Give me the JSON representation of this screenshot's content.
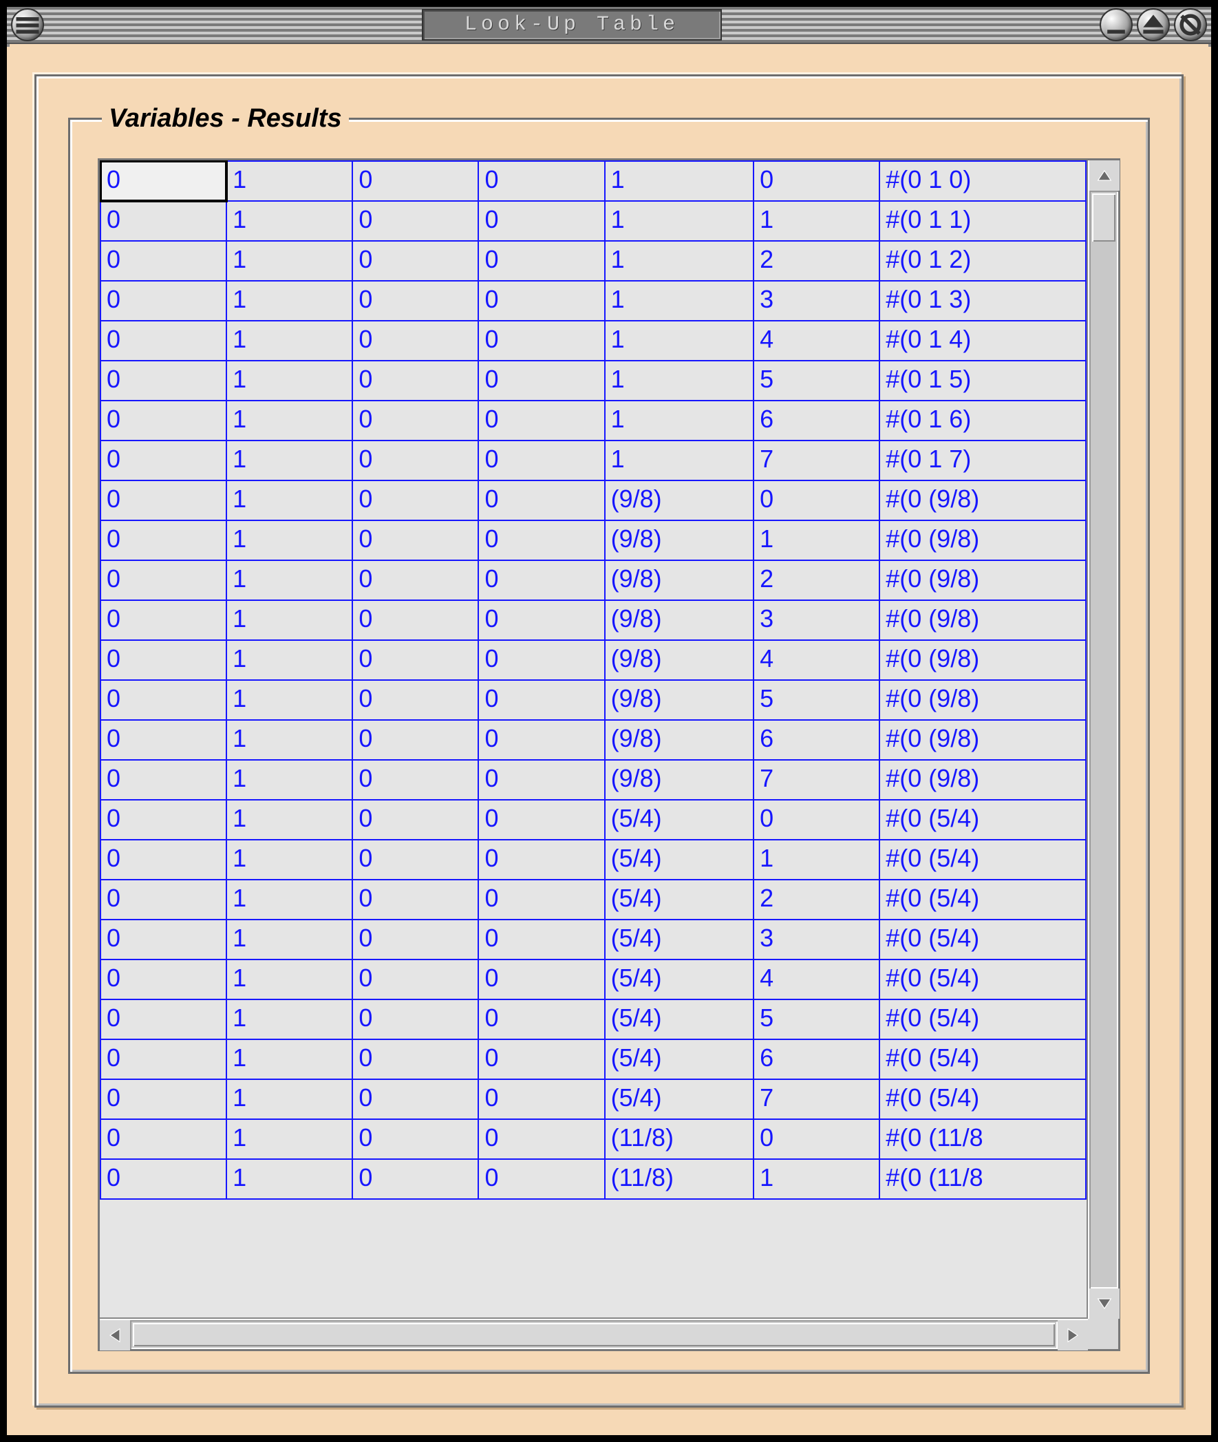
{
  "window": {
    "title": "Look-Up Table",
    "menu_icon": "menu-icon",
    "right_icons": [
      "minimize-icon",
      "maximize-icon",
      "close-icon"
    ]
  },
  "group": {
    "legend": "Variables - Results"
  },
  "table": {
    "columns": 7,
    "selected_cell": [
      0,
      0
    ],
    "rows": [
      [
        "0",
        "1",
        "0",
        "0",
        "1",
        "0",
        "#(0 1 0)"
      ],
      [
        "0",
        "1",
        "0",
        "0",
        "1",
        "1",
        "#(0 1 1)"
      ],
      [
        "0",
        "1",
        "0",
        "0",
        "1",
        "2",
        "#(0 1 2)"
      ],
      [
        "0",
        "1",
        "0",
        "0",
        "1",
        "3",
        "#(0 1 3)"
      ],
      [
        "0",
        "1",
        "0",
        "0",
        "1",
        "4",
        "#(0 1 4)"
      ],
      [
        "0",
        "1",
        "0",
        "0",
        "1",
        "5",
        "#(0 1 5)"
      ],
      [
        "0",
        "1",
        "0",
        "0",
        "1",
        "6",
        "#(0 1 6)"
      ],
      [
        "0",
        "1",
        "0",
        "0",
        "1",
        "7",
        "#(0 1 7)"
      ],
      [
        "0",
        "1",
        "0",
        "0",
        "(9/8)",
        "0",
        "#(0 (9/8)"
      ],
      [
        "0",
        "1",
        "0",
        "0",
        "(9/8)",
        "1",
        "#(0 (9/8)"
      ],
      [
        "0",
        "1",
        "0",
        "0",
        "(9/8)",
        "2",
        "#(0 (9/8)"
      ],
      [
        "0",
        "1",
        "0",
        "0",
        "(9/8)",
        "3",
        "#(0 (9/8)"
      ],
      [
        "0",
        "1",
        "0",
        "0",
        "(9/8)",
        "4",
        "#(0 (9/8)"
      ],
      [
        "0",
        "1",
        "0",
        "0",
        "(9/8)",
        "5",
        "#(0 (9/8)"
      ],
      [
        "0",
        "1",
        "0",
        "0",
        "(9/8)",
        "6",
        "#(0 (9/8)"
      ],
      [
        "0",
        "1",
        "0",
        "0",
        "(9/8)",
        "7",
        "#(0 (9/8)"
      ],
      [
        "0",
        "1",
        "0",
        "0",
        "(5/4)",
        "0",
        "#(0 (5/4)"
      ],
      [
        "0",
        "1",
        "0",
        "0",
        "(5/4)",
        "1",
        "#(0 (5/4)"
      ],
      [
        "0",
        "1",
        "0",
        "0",
        "(5/4)",
        "2",
        "#(0 (5/4)"
      ],
      [
        "0",
        "1",
        "0",
        "0",
        "(5/4)",
        "3",
        "#(0 (5/4)"
      ],
      [
        "0",
        "1",
        "0",
        "0",
        "(5/4)",
        "4",
        "#(0 (5/4)"
      ],
      [
        "0",
        "1",
        "0",
        "0",
        "(5/4)",
        "5",
        "#(0 (5/4)"
      ],
      [
        "0",
        "1",
        "0",
        "0",
        "(5/4)",
        "6",
        "#(0 (5/4)"
      ],
      [
        "0",
        "1",
        "0",
        "0",
        "(5/4)",
        "7",
        "#(0 (5/4)"
      ],
      [
        "0",
        "1",
        "0",
        "0",
        "(11/8)",
        "0",
        "#(0 (11/8"
      ],
      [
        "0",
        "1",
        "0",
        "0",
        "(11/8)",
        "1",
        "#(0 (11/8"
      ]
    ]
  },
  "scrollbars": {
    "vertical": {
      "position": 0.0,
      "thumb_fraction": 0.045
    },
    "horizontal": {
      "position": 0.0,
      "thumb_fraction": 1.0
    }
  }
}
